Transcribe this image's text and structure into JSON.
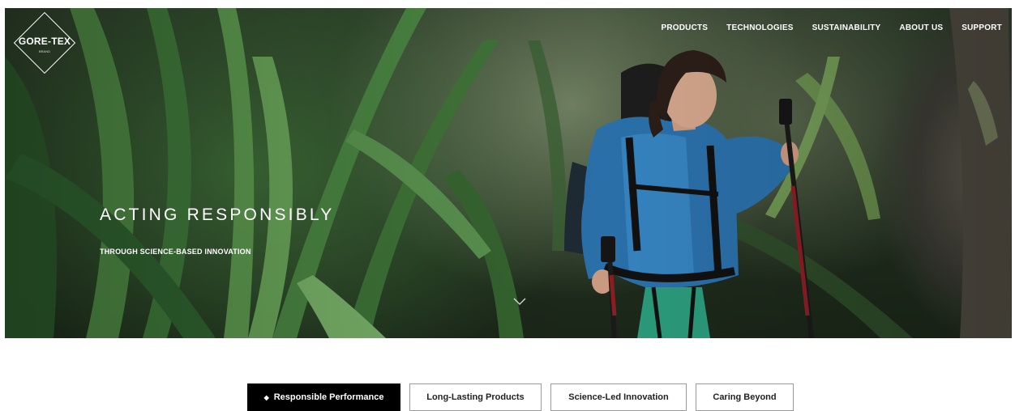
{
  "brand": {
    "logo_text": "GORE-TEX",
    "logo_subtext": "BRAND"
  },
  "nav": {
    "items": [
      {
        "label": "PRODUCTS"
      },
      {
        "label": "TECHNOLOGIES"
      },
      {
        "label": "SUSTAINABILITY"
      },
      {
        "label": "ABOUT US"
      },
      {
        "label": "SUPPORT"
      }
    ]
  },
  "hero": {
    "headline": "ACTING RESPONSIBLY",
    "subheadline": "THROUGH SCIENCE-BASED INNOVATION",
    "scroll_icon": "chevron-down-icon"
  },
  "tabs": [
    {
      "label": "Responsible Performance",
      "active": true,
      "marker": "◆"
    },
    {
      "label": "Long-Lasting Products",
      "active": false
    },
    {
      "label": "Science-Led Innovation",
      "active": false
    },
    {
      "label": "Caring Beyond",
      "active": false
    }
  ],
  "colors": {
    "active_tab_bg": "#000000",
    "active_tab_text": "#ffffff",
    "tab_border": "#9a9a9a",
    "hero_text": "#ffffff"
  }
}
